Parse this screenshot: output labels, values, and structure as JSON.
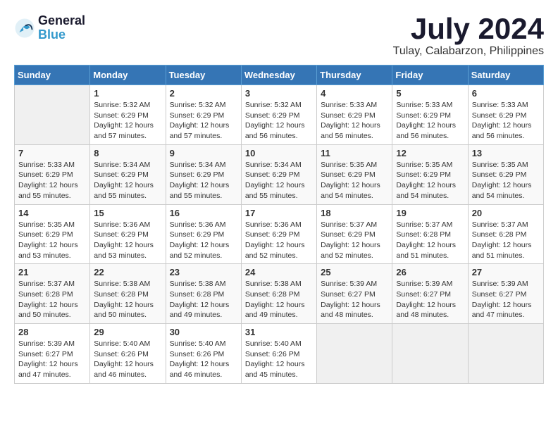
{
  "header": {
    "logo_line1": "General",
    "logo_line2": "Blue",
    "month": "July 2024",
    "location": "Tulay, Calabarzon, Philippines"
  },
  "weekdays": [
    "Sunday",
    "Monday",
    "Tuesday",
    "Wednesday",
    "Thursday",
    "Friday",
    "Saturday"
  ],
  "weeks": [
    [
      {
        "day": "",
        "sunrise": "",
        "sunset": "",
        "daylight": ""
      },
      {
        "day": "1",
        "sunrise": "Sunrise: 5:32 AM",
        "sunset": "Sunset: 6:29 PM",
        "daylight": "Daylight: 12 hours and 57 minutes."
      },
      {
        "day": "2",
        "sunrise": "Sunrise: 5:32 AM",
        "sunset": "Sunset: 6:29 PM",
        "daylight": "Daylight: 12 hours and 57 minutes."
      },
      {
        "day": "3",
        "sunrise": "Sunrise: 5:32 AM",
        "sunset": "Sunset: 6:29 PM",
        "daylight": "Daylight: 12 hours and 56 minutes."
      },
      {
        "day": "4",
        "sunrise": "Sunrise: 5:33 AM",
        "sunset": "Sunset: 6:29 PM",
        "daylight": "Daylight: 12 hours and 56 minutes."
      },
      {
        "day": "5",
        "sunrise": "Sunrise: 5:33 AM",
        "sunset": "Sunset: 6:29 PM",
        "daylight": "Daylight: 12 hours and 56 minutes."
      },
      {
        "day": "6",
        "sunrise": "Sunrise: 5:33 AM",
        "sunset": "Sunset: 6:29 PM",
        "daylight": "Daylight: 12 hours and 56 minutes."
      }
    ],
    [
      {
        "day": "7",
        "sunrise": "Sunrise: 5:33 AM",
        "sunset": "Sunset: 6:29 PM",
        "daylight": "Daylight: 12 hours and 55 minutes."
      },
      {
        "day": "8",
        "sunrise": "Sunrise: 5:34 AM",
        "sunset": "Sunset: 6:29 PM",
        "daylight": "Daylight: 12 hours and 55 minutes."
      },
      {
        "day": "9",
        "sunrise": "Sunrise: 5:34 AM",
        "sunset": "Sunset: 6:29 PM",
        "daylight": "Daylight: 12 hours and 55 minutes."
      },
      {
        "day": "10",
        "sunrise": "Sunrise: 5:34 AM",
        "sunset": "Sunset: 6:29 PM",
        "daylight": "Daylight: 12 hours and 55 minutes."
      },
      {
        "day": "11",
        "sunrise": "Sunrise: 5:35 AM",
        "sunset": "Sunset: 6:29 PM",
        "daylight": "Daylight: 12 hours and 54 minutes."
      },
      {
        "day": "12",
        "sunrise": "Sunrise: 5:35 AM",
        "sunset": "Sunset: 6:29 PM",
        "daylight": "Daylight: 12 hours and 54 minutes."
      },
      {
        "day": "13",
        "sunrise": "Sunrise: 5:35 AM",
        "sunset": "Sunset: 6:29 PM",
        "daylight": "Daylight: 12 hours and 54 minutes."
      }
    ],
    [
      {
        "day": "14",
        "sunrise": "Sunrise: 5:35 AM",
        "sunset": "Sunset: 6:29 PM",
        "daylight": "Daylight: 12 hours and 53 minutes."
      },
      {
        "day": "15",
        "sunrise": "Sunrise: 5:36 AM",
        "sunset": "Sunset: 6:29 PM",
        "daylight": "Daylight: 12 hours and 53 minutes."
      },
      {
        "day": "16",
        "sunrise": "Sunrise: 5:36 AM",
        "sunset": "Sunset: 6:29 PM",
        "daylight": "Daylight: 12 hours and 52 minutes."
      },
      {
        "day": "17",
        "sunrise": "Sunrise: 5:36 AM",
        "sunset": "Sunset: 6:29 PM",
        "daylight": "Daylight: 12 hours and 52 minutes."
      },
      {
        "day": "18",
        "sunrise": "Sunrise: 5:37 AM",
        "sunset": "Sunset: 6:29 PM",
        "daylight": "Daylight: 12 hours and 52 minutes."
      },
      {
        "day": "19",
        "sunrise": "Sunrise: 5:37 AM",
        "sunset": "Sunset: 6:28 PM",
        "daylight": "Daylight: 12 hours and 51 minutes."
      },
      {
        "day": "20",
        "sunrise": "Sunrise: 5:37 AM",
        "sunset": "Sunset: 6:28 PM",
        "daylight": "Daylight: 12 hours and 51 minutes."
      }
    ],
    [
      {
        "day": "21",
        "sunrise": "Sunrise: 5:37 AM",
        "sunset": "Sunset: 6:28 PM",
        "daylight": "Daylight: 12 hours and 50 minutes."
      },
      {
        "day": "22",
        "sunrise": "Sunrise: 5:38 AM",
        "sunset": "Sunset: 6:28 PM",
        "daylight": "Daylight: 12 hours and 50 minutes."
      },
      {
        "day": "23",
        "sunrise": "Sunrise: 5:38 AM",
        "sunset": "Sunset: 6:28 PM",
        "daylight": "Daylight: 12 hours and 49 minutes."
      },
      {
        "day": "24",
        "sunrise": "Sunrise: 5:38 AM",
        "sunset": "Sunset: 6:28 PM",
        "daylight": "Daylight: 12 hours and 49 minutes."
      },
      {
        "day": "25",
        "sunrise": "Sunrise: 5:39 AM",
        "sunset": "Sunset: 6:27 PM",
        "daylight": "Daylight: 12 hours and 48 minutes."
      },
      {
        "day": "26",
        "sunrise": "Sunrise: 5:39 AM",
        "sunset": "Sunset: 6:27 PM",
        "daylight": "Daylight: 12 hours and 48 minutes."
      },
      {
        "day": "27",
        "sunrise": "Sunrise: 5:39 AM",
        "sunset": "Sunset: 6:27 PM",
        "daylight": "Daylight: 12 hours and 47 minutes."
      }
    ],
    [
      {
        "day": "28",
        "sunrise": "Sunrise: 5:39 AM",
        "sunset": "Sunset: 6:27 PM",
        "daylight": "Daylight: 12 hours and 47 minutes."
      },
      {
        "day": "29",
        "sunrise": "Sunrise: 5:40 AM",
        "sunset": "Sunset: 6:26 PM",
        "daylight": "Daylight: 12 hours and 46 minutes."
      },
      {
        "day": "30",
        "sunrise": "Sunrise: 5:40 AM",
        "sunset": "Sunset: 6:26 PM",
        "daylight": "Daylight: 12 hours and 46 minutes."
      },
      {
        "day": "31",
        "sunrise": "Sunrise: 5:40 AM",
        "sunset": "Sunset: 6:26 PM",
        "daylight": "Daylight: 12 hours and 45 minutes."
      },
      {
        "day": "",
        "sunrise": "",
        "sunset": "",
        "daylight": ""
      },
      {
        "day": "",
        "sunrise": "",
        "sunset": "",
        "daylight": ""
      },
      {
        "day": "",
        "sunrise": "",
        "sunset": "",
        "daylight": ""
      }
    ]
  ]
}
